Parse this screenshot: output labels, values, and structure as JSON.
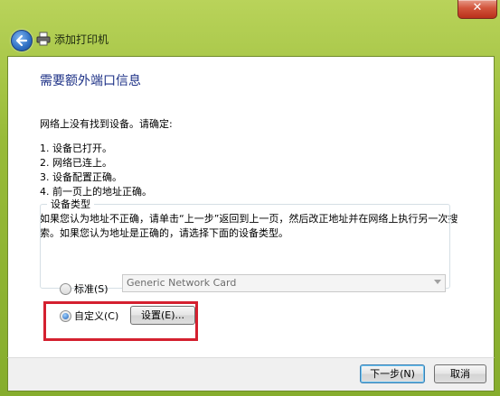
{
  "titlebar": {
    "close_glyph": "✕"
  },
  "nav": {
    "back_icon": "back-arrow-icon",
    "printer_icon": "printer-icon",
    "title": "添加打印机"
  },
  "page": {
    "heading": "需要额外端口信息",
    "intro": "网络上没有找到设备。请确定:",
    "checklist": [
      "1.  设备已打开。",
      "2.  网络已连上。",
      "3.  设备配置正确。",
      "4.  前一页上的地址正确。"
    ],
    "note_line1": "如果您认为地址不正确，请单击“上一步”返回到上一页，然后改正地址并在网络上执行另一次搜",
    "note_line2": "索。如果您认为地址是正确的，请选择下面的设备类型。"
  },
  "device_type": {
    "group_label": "设备类型",
    "standard_label": "标准(S)",
    "standard_selected": false,
    "standard_value": "Generic Network Card",
    "custom_label": "自定义(C)",
    "custom_selected": true,
    "settings_button": "设置(E)..."
  },
  "footer": {
    "next_button": "下一步(N)",
    "cancel_button": "取消"
  },
  "colors": {
    "frame": "#98bb38",
    "heading": "#1e3287",
    "highlight": "#d4202f"
  }
}
